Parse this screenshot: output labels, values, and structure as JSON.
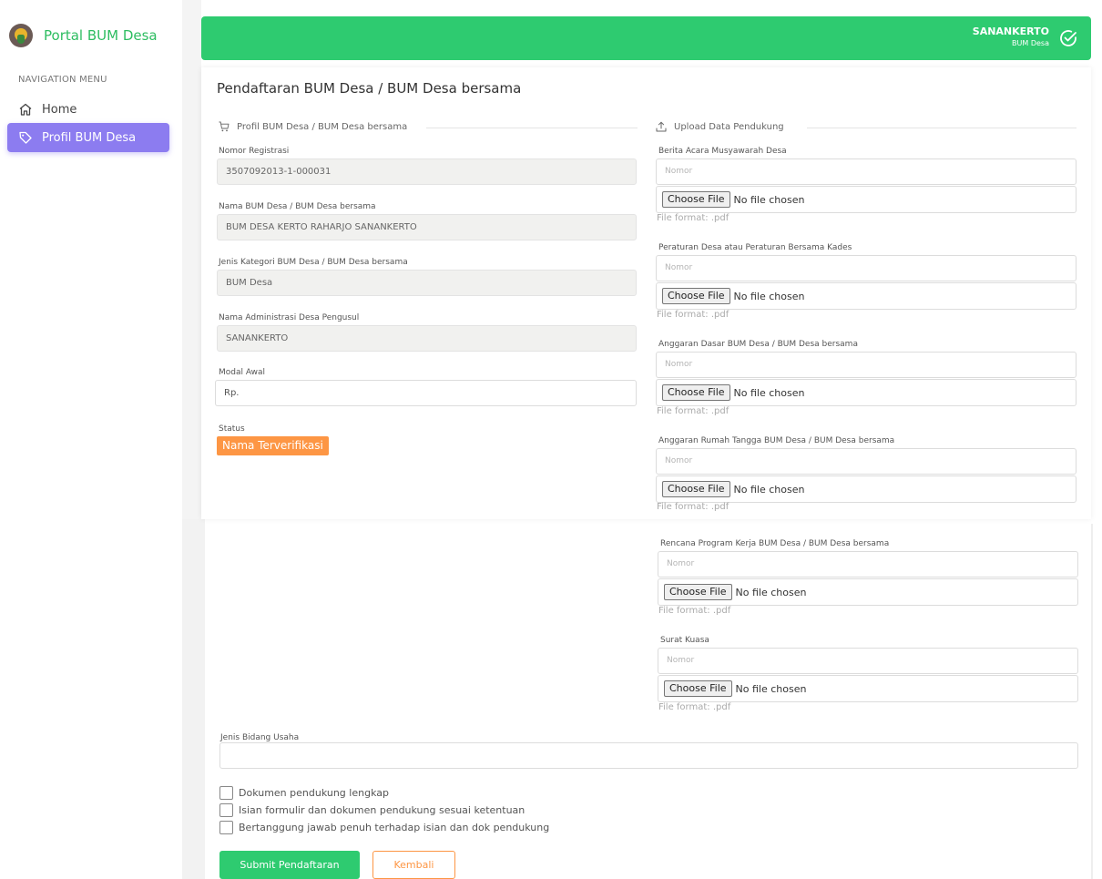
{
  "sidebar": {
    "brand": "Portal BUM Desa",
    "nav_heading": "NAVIGATION MENU",
    "items": [
      {
        "label": "Home",
        "icon": "home-icon"
      },
      {
        "label": "Profil BUM Desa",
        "icon": "tag-icon"
      }
    ]
  },
  "topbar": {
    "user_name": "SANANKERTO",
    "user_role": "BUM Desa",
    "icon": "check-circle-icon",
    "color": "#2ecb70"
  },
  "page": {
    "title": "Pendaftaran BUM Desa / BUM Desa bersama"
  },
  "profil": {
    "section_title": "Profil BUM Desa / BUM Desa bersama",
    "nomor_label": "Nomor Registrasi",
    "nomor_value": "3507092013-1-000031",
    "nama_label": "Nama BUM Desa / BUM Desa bersama",
    "nama_value": "BUM DESA KERTO RAHARJO SANANKERTO",
    "jenis_label": "Jenis Kategori BUM Desa / BUM Desa bersama",
    "jenis_value": "BUM Desa",
    "admin_label": "Nama Administrasi Desa Pengusul",
    "admin_value": "SANANKERTO",
    "modal_label": "Modal Awal",
    "modal_value": "Rp.",
    "status_label": "Status",
    "status_value": "Nama Terverifikasi",
    "status_color": "#fd9644"
  },
  "upload": {
    "section_title": "Upload Data Pendukung",
    "placeholder": "Nomor",
    "choose_label": "Choose File",
    "no_file": "No file chosen",
    "hint": "File format: .pdf",
    "docs": [
      "Berita Acara Musyawarah Desa",
      "Peraturan Desa atau Peraturan Bersama Kades",
      "Anggaran Dasar BUM Desa / BUM Desa bersama",
      "Anggaran Rumah Tangga BUM Desa / BUM Desa bersama",
      "Rencana Program Kerja BUM Desa / BUM Desa bersama",
      "Surat Kuasa"
    ]
  },
  "bidang": {
    "label": "Jenis Bidang Usaha",
    "value": ""
  },
  "checks": [
    "Dokumen pendukung lengkap",
    "Isian formulir dan dokumen pendukung sesuai ketentuan",
    "Bertanggung jawab penuh terhadap isian dan dok pendukung"
  ],
  "actions": {
    "submit": "Submit Pendaftaran",
    "back": "Kembali"
  }
}
